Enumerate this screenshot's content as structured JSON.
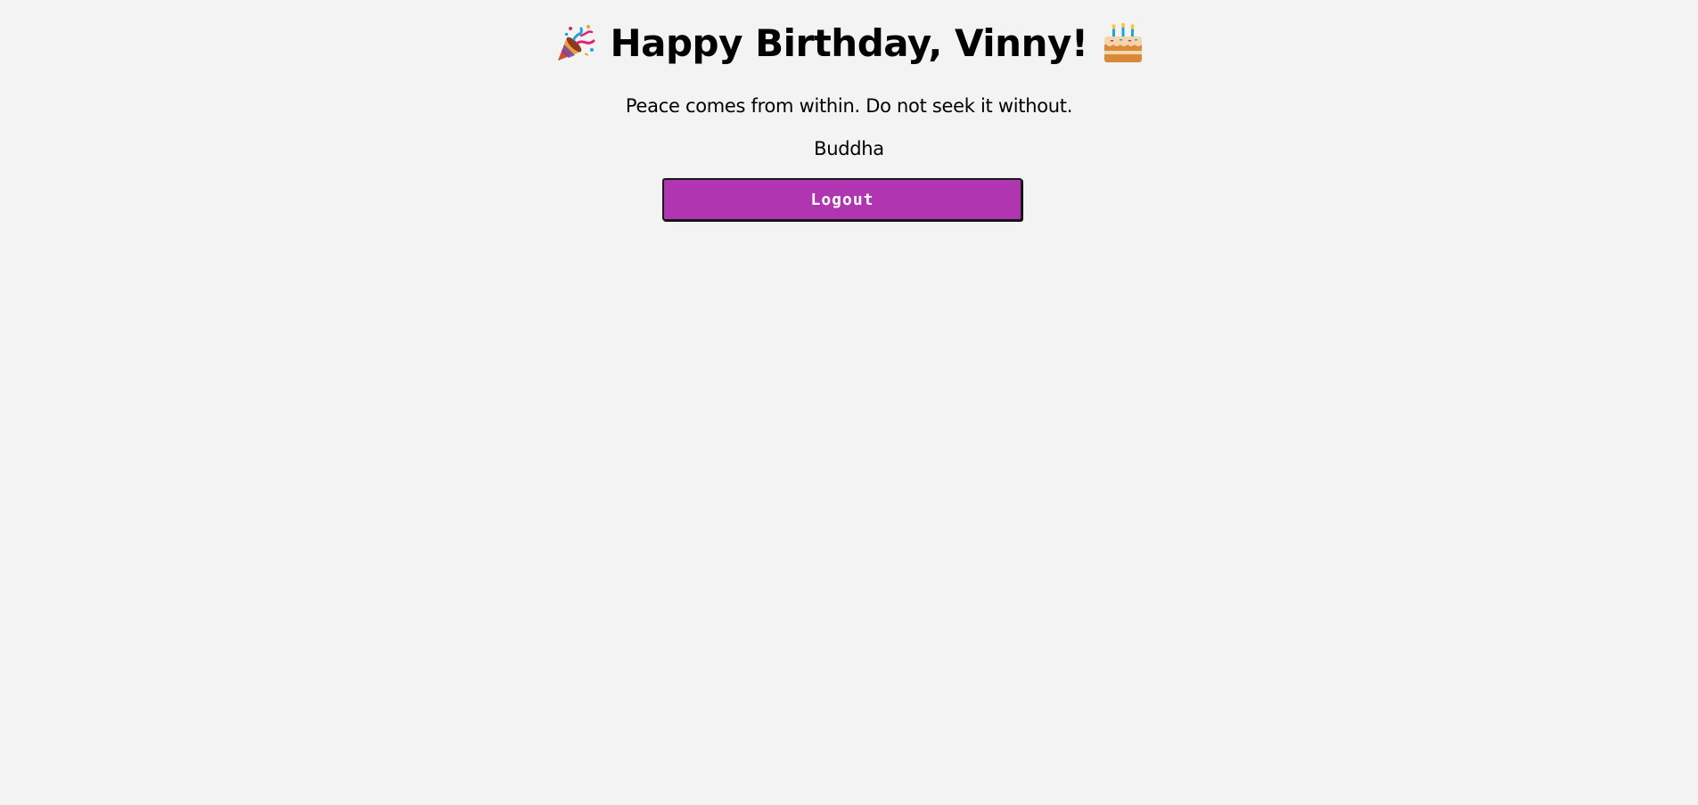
{
  "header": {
    "title": "Happy Birthday, Vinny!",
    "left_icon": "party-popper-icon",
    "right_icon": "birthday-cake-icon"
  },
  "quote": {
    "text": "Peace comes from within. Do not seek it without.",
    "author": "Buddha"
  },
  "actions": {
    "logout_label": "Logout"
  },
  "colors": {
    "background": "#f3f3f3",
    "button_background": "#b035b0",
    "button_text": "#ffffff",
    "text": "#000000"
  }
}
